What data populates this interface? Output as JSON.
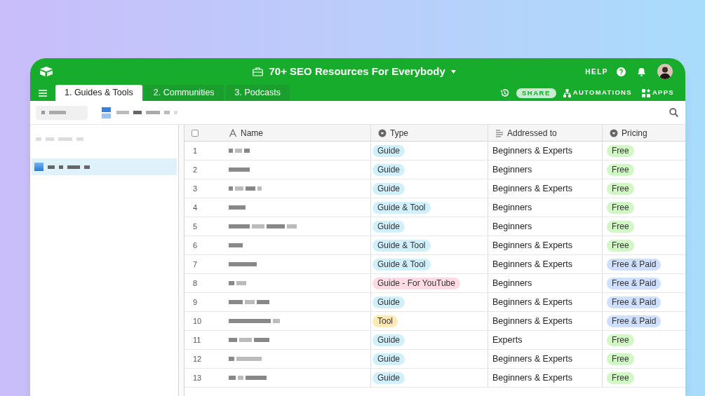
{
  "window": {
    "title": "70+ SEO Resources For Everybody"
  },
  "header": {
    "help": "HELP"
  },
  "tabs": [
    {
      "label": "1. Guides & Tools",
      "selected": true
    },
    {
      "label": "2. Communities",
      "selected": false
    },
    {
      "label": "3. Podcasts",
      "selected": false
    }
  ],
  "actions": {
    "share": "SHARE",
    "automations": "AUTOMATIONS",
    "apps": "APPS"
  },
  "sidebar": {
    "items": [
      {
        "selected": false
      },
      {
        "selected": true
      }
    ]
  },
  "table": {
    "select_all": {
      "checked": false
    },
    "columns": [
      "Name",
      "Type",
      "Addressed to",
      "Pricing"
    ],
    "rows": [
      {
        "number": "1",
        "name_redacted": true,
        "type": {
          "label": "Guide",
          "color": "#d0f0fd"
        },
        "addressed_to": "Beginners & Experts",
        "pricing": {
          "label": "Free",
          "color": "#d1f7c4"
        }
      },
      {
        "number": "2",
        "name_redacted": true,
        "type": {
          "label": "Guide",
          "color": "#d0f0fd"
        },
        "addressed_to": "Beginners",
        "pricing": {
          "label": "Free",
          "color": "#d1f7c4"
        }
      },
      {
        "number": "3",
        "name_redacted": true,
        "type": {
          "label": "Guide",
          "color": "#d0f0fd"
        },
        "addressed_to": "Beginners & Experts",
        "pricing": {
          "label": "Free",
          "color": "#d1f7c4"
        }
      },
      {
        "number": "4",
        "name_redacted": true,
        "type": {
          "label": "Guide & Tool",
          "color": "#d0f0fd"
        },
        "addressed_to": "Beginners",
        "pricing": {
          "label": "Free",
          "color": "#d1f7c4"
        }
      },
      {
        "number": "5",
        "name_redacted": true,
        "type": {
          "label": "Guide",
          "color": "#d0f0fd"
        },
        "addressed_to": "Beginners",
        "pricing": {
          "label": "Free",
          "color": "#d1f7c4"
        }
      },
      {
        "number": "6",
        "name_redacted": true,
        "type": {
          "label": "Guide & Tool",
          "color": "#d0f0fd"
        },
        "addressed_to": "Beginners & Experts",
        "pricing": {
          "label": "Free",
          "color": "#d1f7c4"
        }
      },
      {
        "number": "7",
        "name_redacted": true,
        "type": {
          "label": "Guide & Tool",
          "color": "#d0f0fd"
        },
        "addressed_to": "Beginners & Experts",
        "pricing": {
          "label": "Free & Paid",
          "color": "#cfdfff"
        }
      },
      {
        "number": "8",
        "name_redacted": true,
        "type": {
          "label": "Guide - For YouTube",
          "color": "#ffdce5"
        },
        "addressed_to": "Beginners",
        "pricing": {
          "label": "Free & Paid",
          "color": "#cfdfff"
        }
      },
      {
        "number": "9",
        "name_redacted": true,
        "type": {
          "label": "Guide",
          "color": "#d0f0fd"
        },
        "addressed_to": "Beginners & Experts",
        "pricing": {
          "label": "Free & Paid",
          "color": "#cfdfff"
        }
      },
      {
        "number": "10",
        "name_redacted": true,
        "type": {
          "label": "Tool",
          "color": "#ffeab6"
        },
        "addressed_to": "Beginners & Experts",
        "pricing": {
          "label": "Free & Paid",
          "color": "#cfdfff"
        }
      },
      {
        "number": "11",
        "name_redacted": true,
        "type": {
          "label": "Guide",
          "color": "#d0f0fd"
        },
        "addressed_to": "Experts",
        "pricing": {
          "label": "Free",
          "color": "#d1f7c4"
        }
      },
      {
        "number": "12",
        "name_redacted": true,
        "type": {
          "label": "Guide",
          "color": "#d0f0fd"
        },
        "addressed_to": "Beginners & Experts",
        "pricing": {
          "label": "Free",
          "color": "#d1f7c4"
        }
      },
      {
        "number": "13",
        "name_redacted": true,
        "type": {
          "label": "Guide",
          "color": "#d0f0fd"
        },
        "addressed_to": "Beginners & Experts",
        "pricing": {
          "label": "Free",
          "color": "#d1f7c4"
        }
      }
    ]
  }
}
